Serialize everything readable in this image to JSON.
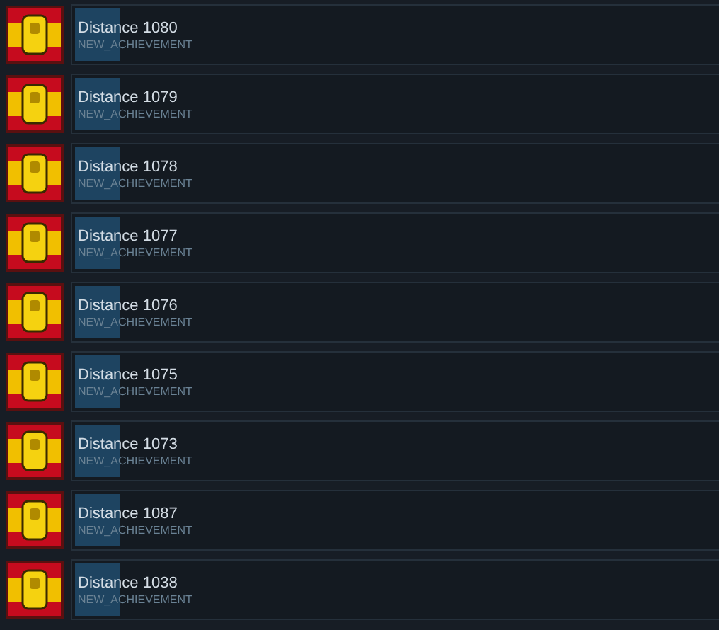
{
  "achievements": [
    {
      "title": "Distance 1080",
      "subtitle": "NEW_ACHIEVEMENT",
      "level": 0.07
    },
    {
      "title": "Distance 1079",
      "subtitle": "NEW_ACHIEVEMENT",
      "level": 0.07
    },
    {
      "title": "Distance 1078",
      "subtitle": "NEW_ACHIEVEMENT",
      "level": 0.07
    },
    {
      "title": "Distance 1077",
      "subtitle": "NEW_ACHIEVEMENT",
      "level": 0.07
    },
    {
      "title": "Distance 1076",
      "subtitle": "NEW_ACHIEVEMENT",
      "level": 0.07
    },
    {
      "title": "Distance 1075",
      "subtitle": "NEW_ACHIEVEMENT",
      "level": 0.07
    },
    {
      "title": "Distance 1073",
      "subtitle": "NEW_ACHIEVEMENT",
      "level": 0.07
    },
    {
      "title": "Distance 1087",
      "subtitle": "NEW_ACHIEVEMENT",
      "level": 0.07
    },
    {
      "title": "Distance 1038",
      "subtitle": "NEW_ACHIEVEMENT",
      "level": 0.07
    }
  ]
}
